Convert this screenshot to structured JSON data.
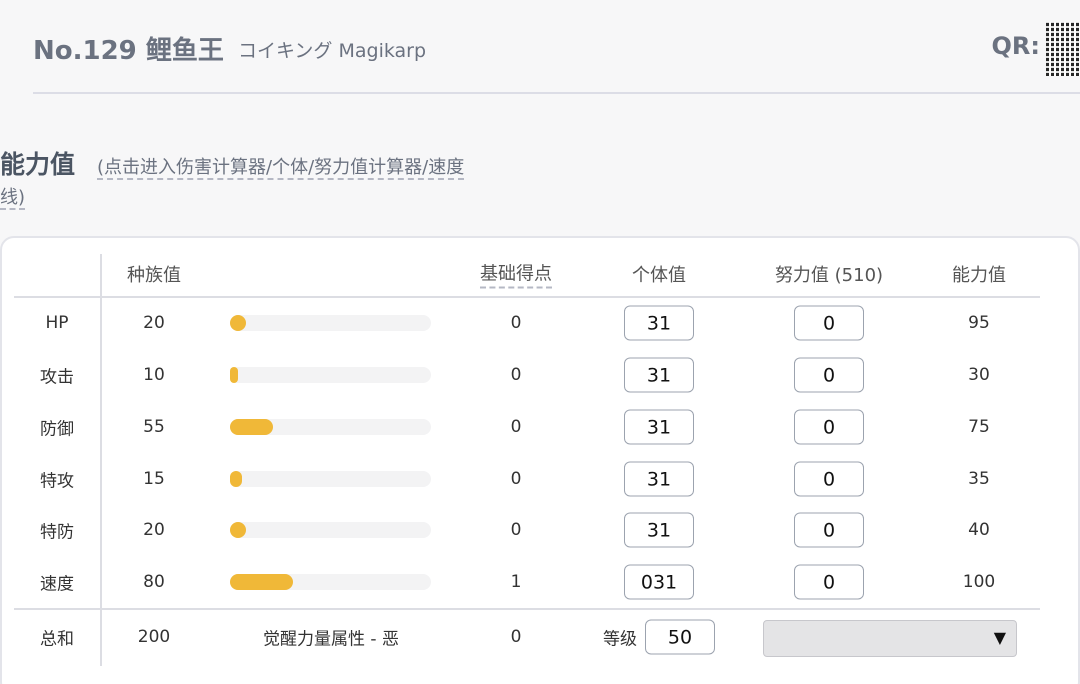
{
  "header": {
    "number_name": "No.129 鲤鱼王",
    "names_alt": "コイキング Magikarp",
    "qr_label": "QR:"
  },
  "section": {
    "title": "能力值",
    "link_line1": "(点击进入伤害计算器/个体/努力值计算器/速度",
    "link_line2": "线)"
  },
  "table": {
    "headers": {
      "base": "种族值",
      "ev_yield": "基础得点",
      "iv": "个体值",
      "ev": "努力值 (510)",
      "stat": "能力值"
    },
    "base_max": 255,
    "rows": [
      {
        "label": "HP",
        "base": "20",
        "ev_yield": "0",
        "iv": "31",
        "ev": "0",
        "stat": "95"
      },
      {
        "label": "攻击",
        "base": "10",
        "ev_yield": "0",
        "iv": "31",
        "ev": "0",
        "stat": "30"
      },
      {
        "label": "防御",
        "base": "55",
        "ev_yield": "0",
        "iv": "31",
        "ev": "0",
        "stat": "75"
      },
      {
        "label": "特攻",
        "base": "15",
        "ev_yield": "0",
        "iv": "31",
        "ev": "0",
        "stat": "35"
      },
      {
        "label": "特防",
        "base": "20",
        "ev_yield": "0",
        "iv": "31",
        "ev": "0",
        "stat": "40"
      },
      {
        "label": "速度",
        "base": "80",
        "ev_yield": "1",
        "iv": "031",
        "ev": "0",
        "stat": "100"
      }
    ],
    "total": {
      "label": "总和",
      "base": "200",
      "hidden_power": "觉醒力量属性 - 恶",
      "ev_yield": "0",
      "level_label": "等级",
      "level_value": "50",
      "nature_value": ""
    },
    "bar_color": "#f0b838"
  },
  "icons": {
    "dropdown": "▼"
  }
}
